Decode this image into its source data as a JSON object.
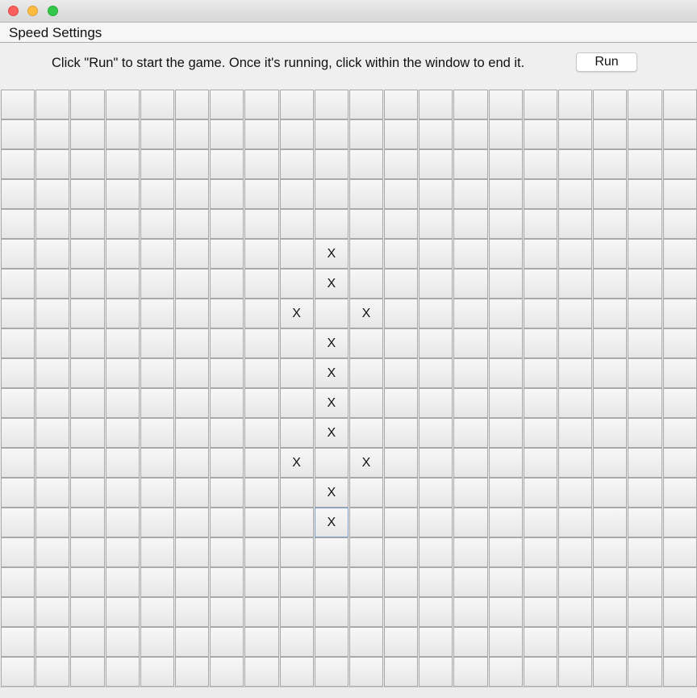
{
  "menubar": {
    "title": "Speed Settings"
  },
  "instructions": {
    "text": "Click \"Run\" to start the game. Once it's running, click within the window to end it.",
    "run_label": "Run"
  },
  "grid": {
    "rows": 20,
    "cols": 20,
    "marker": "X",
    "marked_cells": [
      [
        5,
        9
      ],
      [
        6,
        9
      ],
      [
        7,
        8
      ],
      [
        7,
        10
      ],
      [
        8,
        9
      ],
      [
        9,
        9
      ],
      [
        10,
        9
      ],
      [
        11,
        9
      ],
      [
        12,
        8
      ],
      [
        12,
        10
      ],
      [
        13,
        9
      ],
      [
        14,
        9
      ]
    ],
    "focused_cell": [
      14,
      9
    ]
  }
}
